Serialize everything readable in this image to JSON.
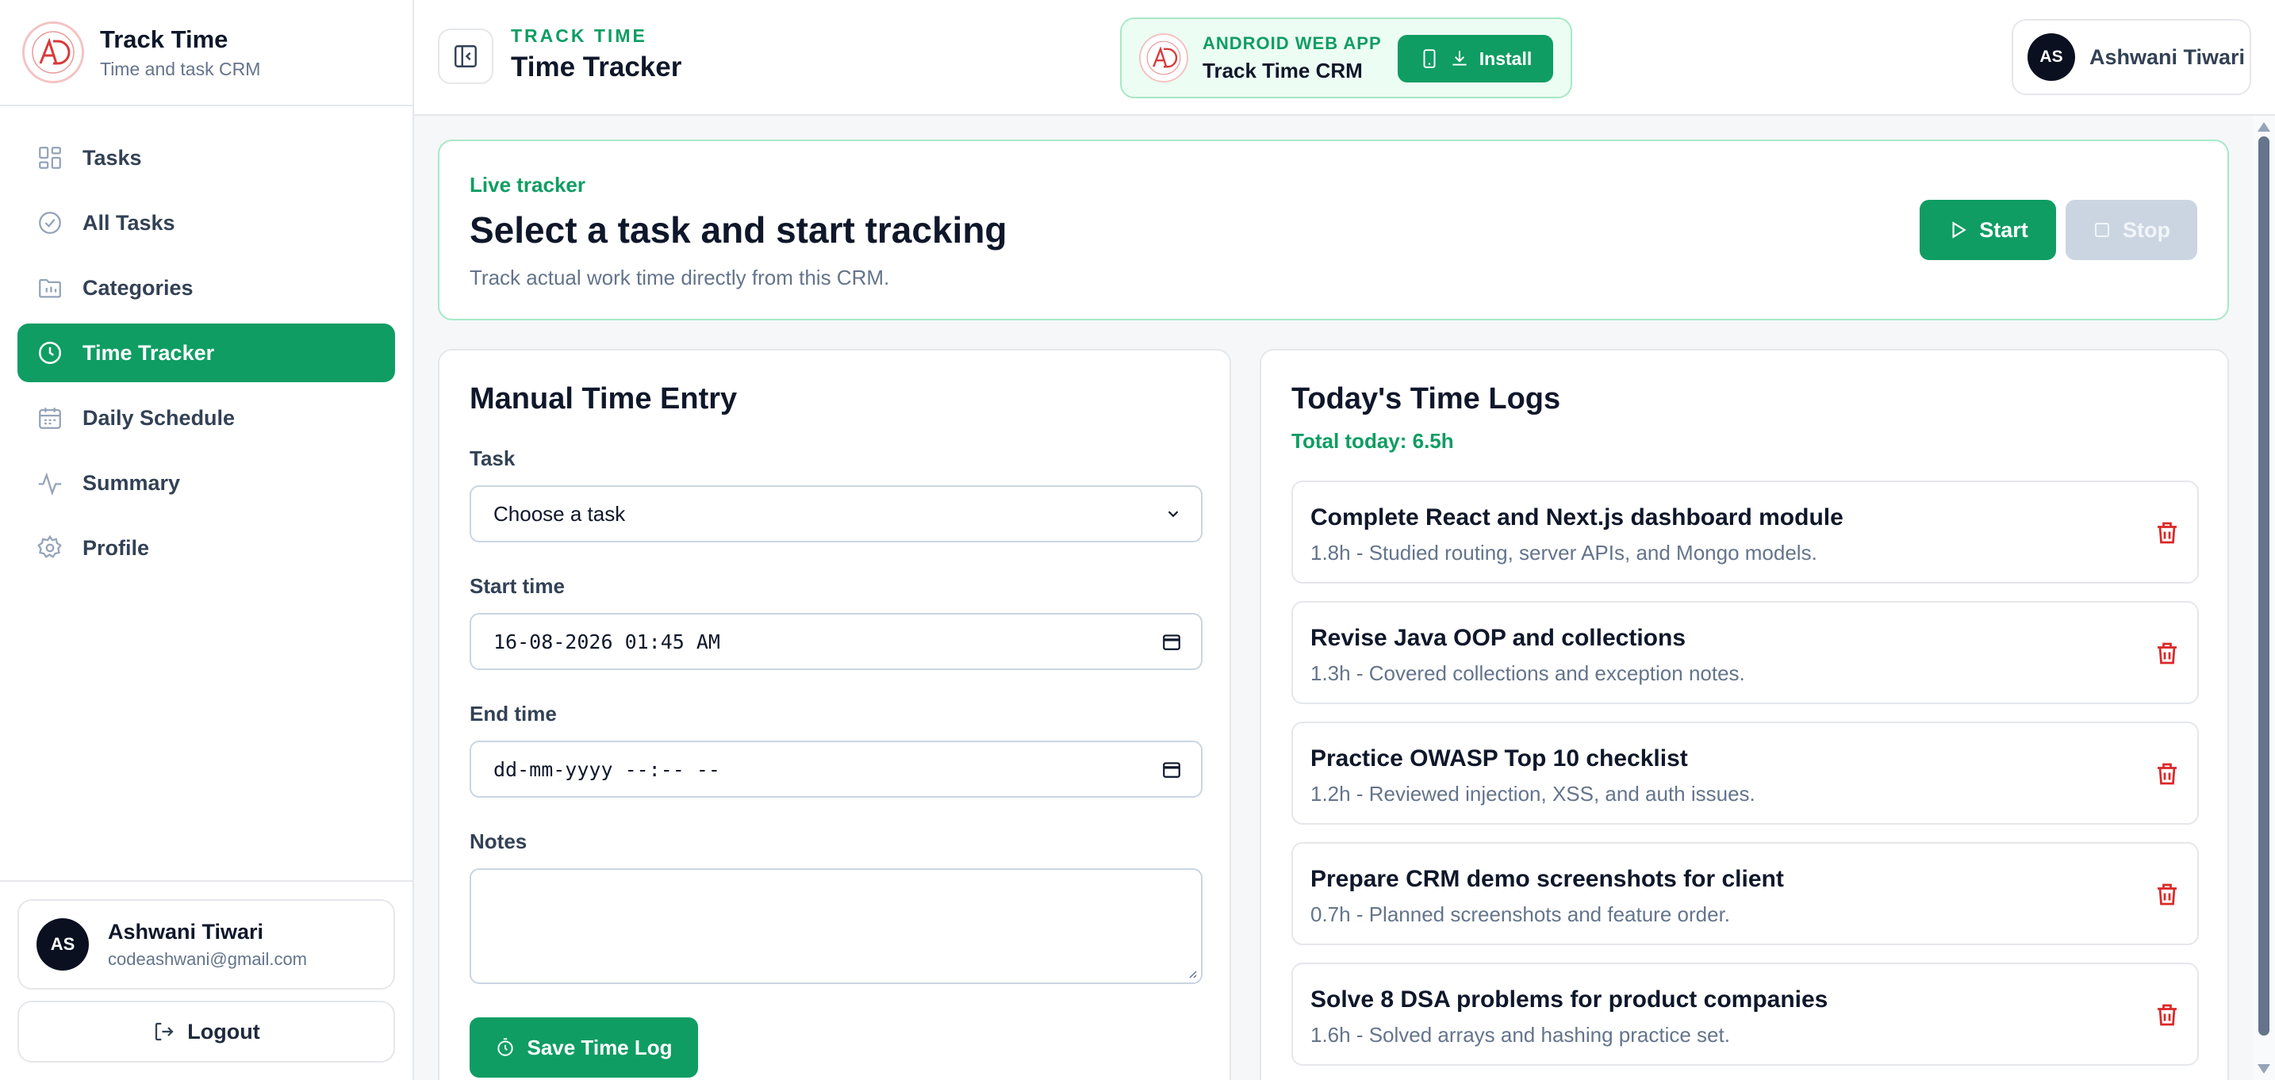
{
  "brand": {
    "title": "Track Time",
    "subtitle": "Time and task CRM"
  },
  "sidebar": {
    "items": [
      {
        "label": "Tasks",
        "icon": "grid-icon"
      },
      {
        "label": "All Tasks",
        "icon": "check-circle-icon"
      },
      {
        "label": "Categories",
        "icon": "folder-icon"
      },
      {
        "label": "Time Tracker",
        "icon": "clock-icon",
        "active": true
      },
      {
        "label": "Daily Schedule",
        "icon": "calendar-icon"
      },
      {
        "label": "Summary",
        "icon": "activity-icon"
      },
      {
        "label": "Profile",
        "icon": "gear-icon"
      }
    ],
    "user": {
      "initials": "AS",
      "name": "Ashwani Tiwari",
      "email": "codeashwani@gmail.com"
    },
    "logout_label": "Logout"
  },
  "header": {
    "eyebrow": "TRACK TIME",
    "title": "Time Tracker",
    "banner": {
      "eyebrow": "ANDROID WEB APP",
      "title": "Track Time CRM",
      "install_label": "Install"
    },
    "user": {
      "initials": "AS",
      "name": "Ashwani Tiwari"
    }
  },
  "hero": {
    "eyebrow": "Live tracker",
    "title": "Select a task and start tracking",
    "subtitle": "Track actual work time directly from this CRM.",
    "start_label": "Start",
    "stop_label": "Stop"
  },
  "manual": {
    "title": "Manual Time Entry",
    "task_label": "Task",
    "task_value": "Choose a task",
    "start_label": "Start time",
    "start_value": "16-08-2026 01:45 AM",
    "end_label": "End time",
    "end_placeholder": "dd-mm-yyyy --:-- --",
    "notes_label": "Notes",
    "notes_value": "",
    "save_label": "Save Time Log"
  },
  "logs": {
    "title": "Today's Time Logs",
    "total": "Total today: 6.5h",
    "items": [
      {
        "title": "Complete React and Next.js dashboard module",
        "desc": "1.8h - Studied routing, server APIs, and Mongo models."
      },
      {
        "title": "Revise Java OOP and collections",
        "desc": "1.3h - Covered collections and exception notes."
      },
      {
        "title": "Practice OWASP Top 10 checklist",
        "desc": "1.2h - Reviewed injection, XSS, and auth issues."
      },
      {
        "title": "Prepare CRM demo screenshots for client",
        "desc": "0.7h - Planned screenshots and feature order."
      },
      {
        "title": "Solve 8 DSA problems for product companies",
        "desc": "1.6h - Solved arrays and hashing practice set."
      }
    ]
  },
  "colors": {
    "accent": "#0f9d63",
    "danger": "#dc2626",
    "logo_red": "#d93a3a"
  }
}
